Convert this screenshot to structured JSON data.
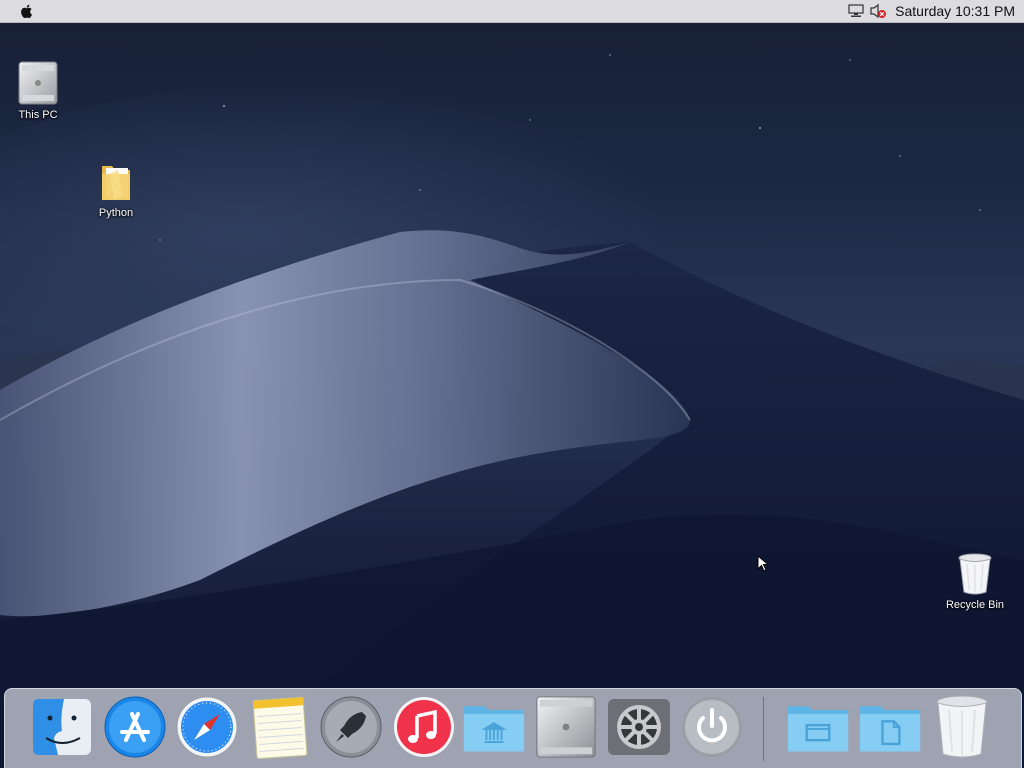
{
  "menubar": {
    "apple_icon": "apple-logo-icon",
    "network_icon": "network-icon",
    "volume_icon": "volume-muted-icon",
    "clock": "Saturday 10:31 PM"
  },
  "desktop": {
    "this_pc_label": "This PC",
    "python_label": "Python",
    "recycle_bin_label": "Recycle Bin"
  },
  "dock": {
    "items": [
      {
        "icon": "finder-icon"
      },
      {
        "icon": "app-store-icon"
      },
      {
        "icon": "safari-icon"
      },
      {
        "icon": "notes-icon"
      },
      {
        "icon": "launchpad-icon"
      },
      {
        "icon": "itunes-icon"
      },
      {
        "icon": "library-folder-icon"
      },
      {
        "icon": "mac-pro-icon"
      },
      {
        "icon": "system-preferences-icon"
      },
      {
        "icon": "power-icon"
      },
      {
        "icon": "desktop-folder-icon"
      },
      {
        "icon": "documents-folder-icon"
      },
      {
        "icon": "trash-icon"
      }
    ]
  },
  "colors": {
    "menubar_bg": "#dcdce0",
    "sky_top": "#161f35",
    "dune_light": "#9aa6c4",
    "folder_blue": "#6ec2ee"
  }
}
